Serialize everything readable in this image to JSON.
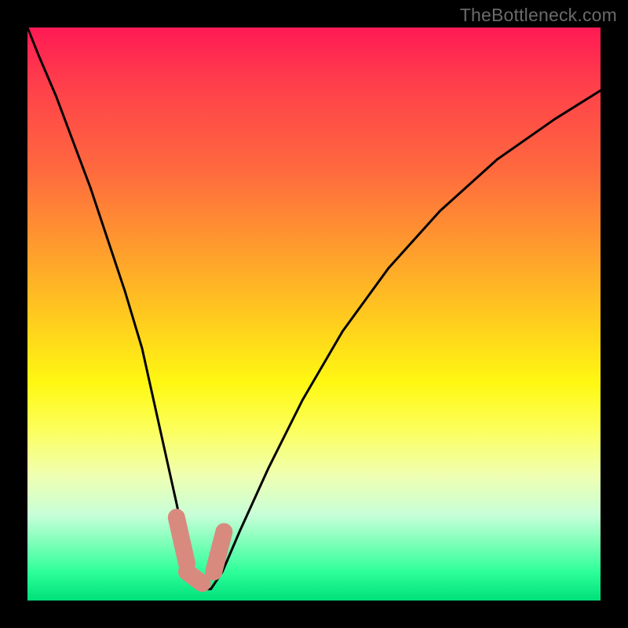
{
  "attribution": "TheBottleneck.com",
  "chart_data": {
    "type": "line",
    "title": "",
    "xlabel": "",
    "ylabel": "",
    "xlim": [
      0,
      100
    ],
    "ylim": [
      0,
      100
    ],
    "series": [
      {
        "name": "bottleneck-curve",
        "x": [
          0,
          2,
          5,
          8,
          11,
          14,
          17,
          20,
          22,
          24,
          26,
          27.5,
          29,
          30.5,
          32,
          34,
          37,
          42,
          48,
          55,
          63,
          72,
          82,
          92,
          100
        ],
        "values": [
          100,
          95,
          88,
          80,
          72,
          63,
          54,
          44,
          35,
          26,
          17,
          10,
          5,
          2,
          2,
          5,
          12,
          23,
          35,
          47,
          58,
          68,
          77,
          84,
          89
        ]
      }
    ],
    "annotations": [
      {
        "name": "marker-seg-1",
        "shape": "rounded",
        "color": "#d88a7f",
        "x0": 26.0,
        "y0": 14.5,
        "x1": 27.8,
        "y1": 6.5
      },
      {
        "name": "marker-seg-2",
        "shape": "rounded",
        "color": "#d88a7f",
        "x0": 27.8,
        "y0": 5.0,
        "x1": 30.5,
        "y1": 3.0
      },
      {
        "name": "marker-seg-3",
        "shape": "rounded",
        "color": "#d88a7f",
        "x0": 32.5,
        "y0": 5.0,
        "x1": 34.3,
        "y1": 12.0
      }
    ]
  }
}
